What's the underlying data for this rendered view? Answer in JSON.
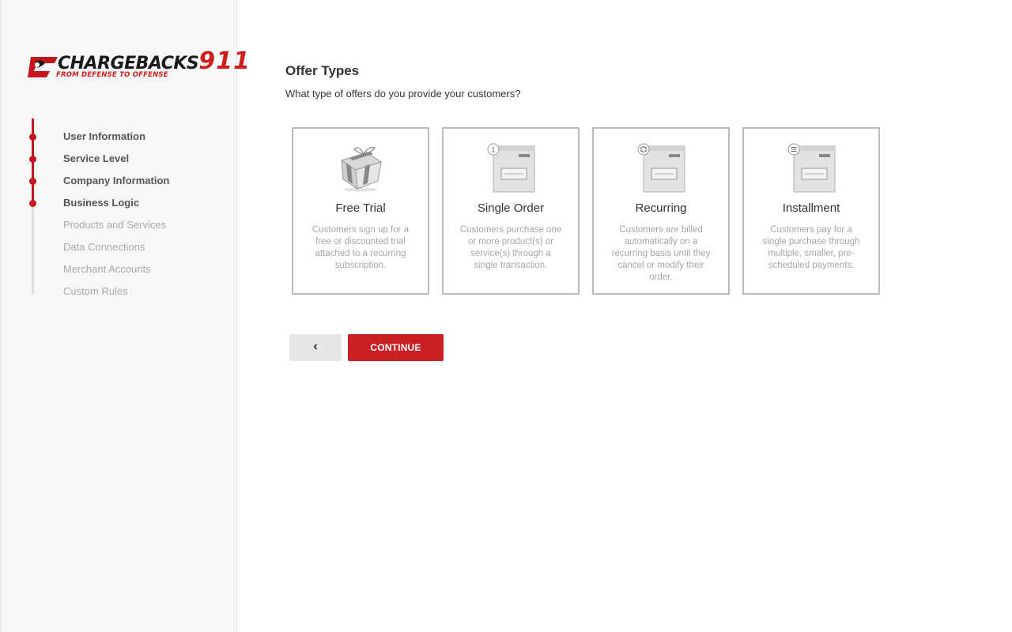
{
  "brand": {
    "name": "CHARGEBACKS",
    "number": "911",
    "tagline": "FROM DEFENSE TO OFFENSE",
    "accent": "#c4161c"
  },
  "steps": [
    {
      "label": "User Information",
      "status": "complete"
    },
    {
      "label": "Service Level",
      "status": "complete"
    },
    {
      "label": "Company Information",
      "status": "complete"
    },
    {
      "label": "Business Logic",
      "status": "complete"
    },
    {
      "label": "Products and Services",
      "status": "pending"
    },
    {
      "label": "Data Connections",
      "status": "pending"
    },
    {
      "label": "Merchant Accounts",
      "status": "pending"
    },
    {
      "label": "Custom Rules",
      "status": "pending"
    }
  ],
  "main": {
    "title": "Offer Types",
    "subtitle": "What type of offers do you provide your customers?"
  },
  "offers": [
    {
      "title": "Free Trial",
      "icon": "gift-icon",
      "description": "Customers sign up for a free or discounted trial attached to a recurring subscription."
    },
    {
      "title": "Single Order",
      "icon": "single-order-box-icon",
      "badge": "1",
      "description": "Customers purchase one or more product(s) or service(s) through a single transaction."
    },
    {
      "title": "Recurring",
      "icon": "recurring-box-icon",
      "description": "Customers are billed automatically on a recurring basis until they cancel or modify their order."
    },
    {
      "title": "Installment",
      "icon": "installment-box-icon",
      "description": "Customers pay for a single purchase through multiple, smaller, pre-scheduled payments."
    }
  ],
  "actions": {
    "back_icon": "chevron-left-icon",
    "back_glyph": "‹",
    "continue_label": "CONTINUE"
  }
}
